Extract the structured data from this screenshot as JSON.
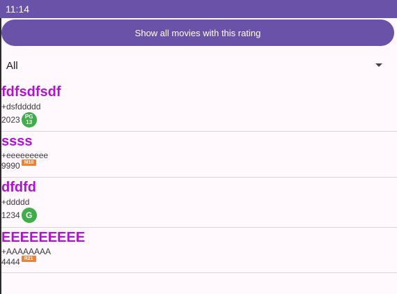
{
  "status_bar": {
    "time": "11:14"
  },
  "main_button": {
    "label": "Show all movies with this rating"
  },
  "filter": {
    "selected": "All"
  },
  "movies": [
    {
      "title": "fdfsdfsdf",
      "subtitle": "+dsfddddd",
      "year": "2023",
      "rating_top": "PG",
      "rating_bottom": "13",
      "rating_style": "circle-green-two-line"
    },
    {
      "title": "ssss",
      "subtitle": "+eeeeeeeee",
      "year": "9990",
      "rating": "M18",
      "rating_style": "tag-orange"
    },
    {
      "title": "dfdfd",
      "subtitle": "+ddddd",
      "year": "1234",
      "rating": "G",
      "rating_style": "circle-green"
    },
    {
      "title": "EEEEEEEEE",
      "subtitle": "+AAAAAAAA",
      "year": "4444",
      "rating": "R21",
      "rating_style": "tag-orange"
    }
  ],
  "colors": {
    "primary": "#6a52a8",
    "title": "#b310d6",
    "rating_green": "#3fae49",
    "rating_orange": "#ee8233",
    "background": "#fff9fd"
  }
}
